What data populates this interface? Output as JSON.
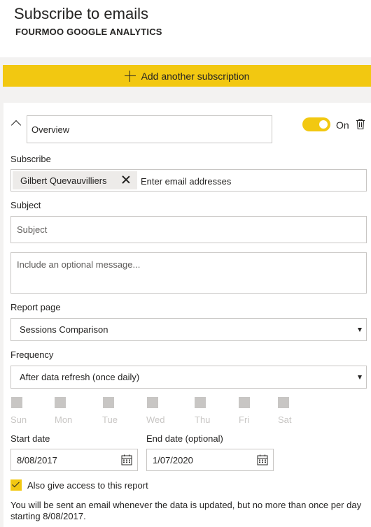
{
  "header": {
    "title": "Subscribe to emails",
    "report_name": "FOURMOO GOOGLE ANALYTICS"
  },
  "actions": {
    "add_subscription_label": "Add another subscription"
  },
  "subscription": {
    "name_value": "Overview",
    "toggle": {
      "state": true,
      "label": "On"
    },
    "subscribe": {
      "label": "Subscribe",
      "recipients": [
        "Gilbert Quevauvilliers"
      ],
      "placeholder": "Enter email addresses"
    },
    "subject": {
      "label": "Subject",
      "placeholder": "Subject"
    },
    "message": {
      "placeholder": "Include an optional message..."
    },
    "report_page": {
      "label": "Report page",
      "selected": "Sessions Comparison"
    },
    "frequency": {
      "label": "Frequency",
      "selected": "After data refresh (once daily)"
    },
    "days": [
      {
        "label": "Sun",
        "checked": false
      },
      {
        "label": "Mon",
        "checked": false
      },
      {
        "label": "Tue",
        "checked": false
      },
      {
        "label": "Wed",
        "checked": false
      },
      {
        "label": "Thu",
        "checked": false
      },
      {
        "label": "Fri",
        "checked": false
      },
      {
        "label": "Sat",
        "checked": false
      }
    ],
    "start_date": {
      "label": "Start date",
      "value": "8/08/2017"
    },
    "end_date": {
      "label": "End date (optional)",
      "value": "1/07/2020"
    },
    "give_access": {
      "checked": true,
      "label": "Also give access to this report"
    },
    "note": "You will be sent an email whenever the data is updated, but no more than once per day starting 8/08/2017."
  },
  "colors": {
    "accent": "#f2c811",
    "text": "#252423",
    "border": "#c8c6c4",
    "disabled": "#c8c6c4",
    "band": "#f3f2f1"
  },
  "icons": {
    "add": "plus-icon",
    "collapse": "chevron-up-icon",
    "delete": "trash-icon",
    "remove_recipient": "close-icon",
    "dropdown": "caret-down-icon",
    "calendar": "calendar-icon",
    "check": "checkmark-icon"
  }
}
